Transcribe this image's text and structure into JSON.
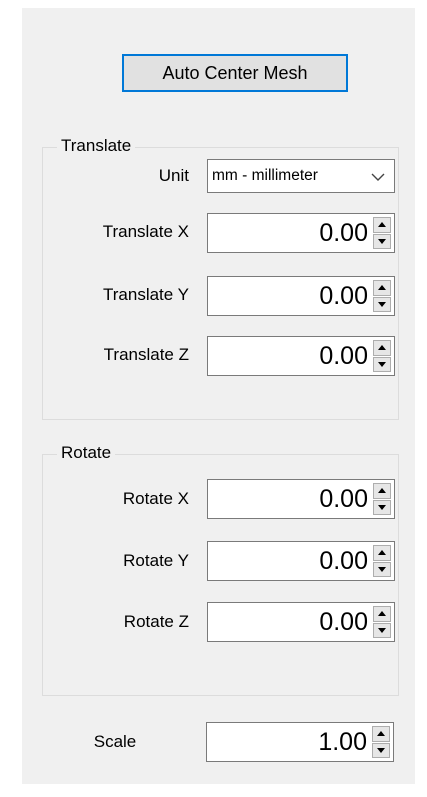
{
  "buttons": {
    "auto_center": "Auto Center Mesh"
  },
  "translate": {
    "title": "Translate",
    "unit_label": "Unit",
    "unit_value": "mm - millimeter",
    "fields": [
      {
        "label": "Translate X",
        "value": "0.00"
      },
      {
        "label": "Translate Y",
        "value": "0.00"
      },
      {
        "label": "Translate Z",
        "value": "0.00"
      }
    ]
  },
  "rotate": {
    "title": "Rotate",
    "fields": [
      {
        "label": "Rotate X",
        "value": "0.00"
      },
      {
        "label": "Rotate Y",
        "value": "0.00"
      },
      {
        "label": "Rotate Z",
        "value": "0.00"
      }
    ]
  },
  "scale": {
    "label": "Scale",
    "value": "1.00"
  },
  "icons": {
    "dropdown": "chevron-down-icon",
    "spin_up": "spin-up-icon",
    "spin_down": "spin-down-icon"
  },
  "colors": {
    "panel_bg": "#f0f0f0",
    "focus_border": "#0078d7"
  }
}
